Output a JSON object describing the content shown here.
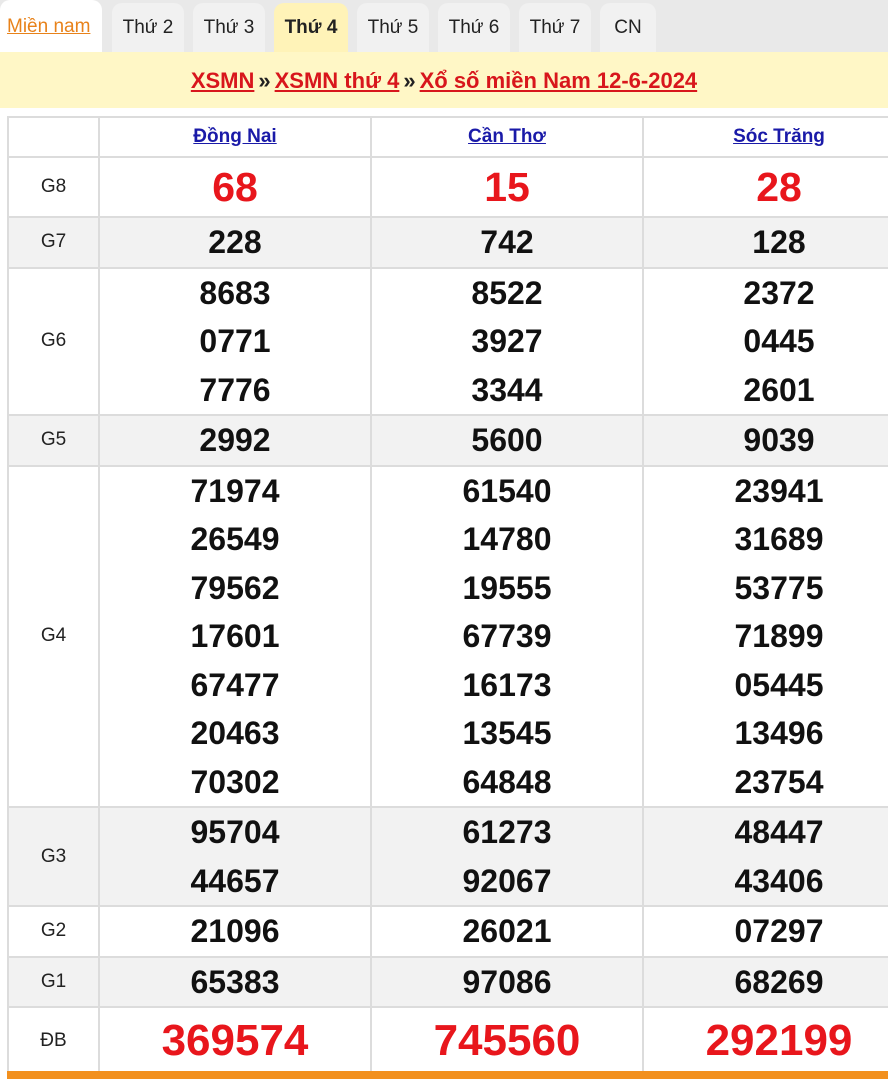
{
  "tabs": {
    "home": "Miền nam",
    "days": [
      "Thứ 2",
      "Thứ 3",
      "Thứ 4",
      "Thứ 5",
      "Thứ 6",
      "Thứ 7",
      "CN"
    ],
    "active_index": 2
  },
  "breadcrumb": {
    "part1": "XSMN",
    "sep": "»",
    "part2": "XSMN thứ 4",
    "part3": "Xổ số miền Nam 12-6-2024"
  },
  "colors": {
    "accent_red": "#d8161c",
    "link_blue": "#1a1aa8",
    "tab_home": "#e8821a",
    "bar_yellow": "#fff7c6",
    "bottom_orange": "#f2901e"
  },
  "provinces": [
    "Đồng Nai",
    "Cần Thơ",
    "Sóc Trăng"
  ],
  "prizes": [
    {
      "label": "G8",
      "values": [
        [
          "68"
        ],
        [
          "15"
        ],
        [
          "28"
        ]
      ]
    },
    {
      "label": "G7",
      "values": [
        [
          "228"
        ],
        [
          "742"
        ],
        [
          "128"
        ]
      ]
    },
    {
      "label": "G6",
      "values": [
        [
          "8683",
          "0771",
          "7776"
        ],
        [
          "8522",
          "3927",
          "3344"
        ],
        [
          "2372",
          "0445",
          "2601"
        ]
      ]
    },
    {
      "label": "G5",
      "values": [
        [
          "2992"
        ],
        [
          "5600"
        ],
        [
          "9039"
        ]
      ]
    },
    {
      "label": "G4",
      "values": [
        [
          "71974",
          "26549",
          "79562",
          "17601",
          "67477",
          "20463",
          "70302"
        ],
        [
          "61540",
          "14780",
          "19555",
          "67739",
          "16173",
          "13545",
          "64848"
        ],
        [
          "23941",
          "31689",
          "53775",
          "71899",
          "05445",
          "13496",
          "23754"
        ]
      ]
    },
    {
      "label": "G3",
      "values": [
        [
          "95704",
          "44657"
        ],
        [
          "61273",
          "92067"
        ],
        [
          "48447",
          "43406"
        ]
      ]
    },
    {
      "label": "G2",
      "values": [
        [
          "21096"
        ],
        [
          "26021"
        ],
        [
          "07297"
        ]
      ]
    },
    {
      "label": "G1",
      "values": [
        [
          "65383"
        ],
        [
          "97086"
        ],
        [
          "68269"
        ]
      ]
    },
    {
      "label": "ĐB",
      "values": [
        [
          "369574"
        ],
        [
          "745560"
        ],
        [
          "292199"
        ]
      ]
    }
  ]
}
